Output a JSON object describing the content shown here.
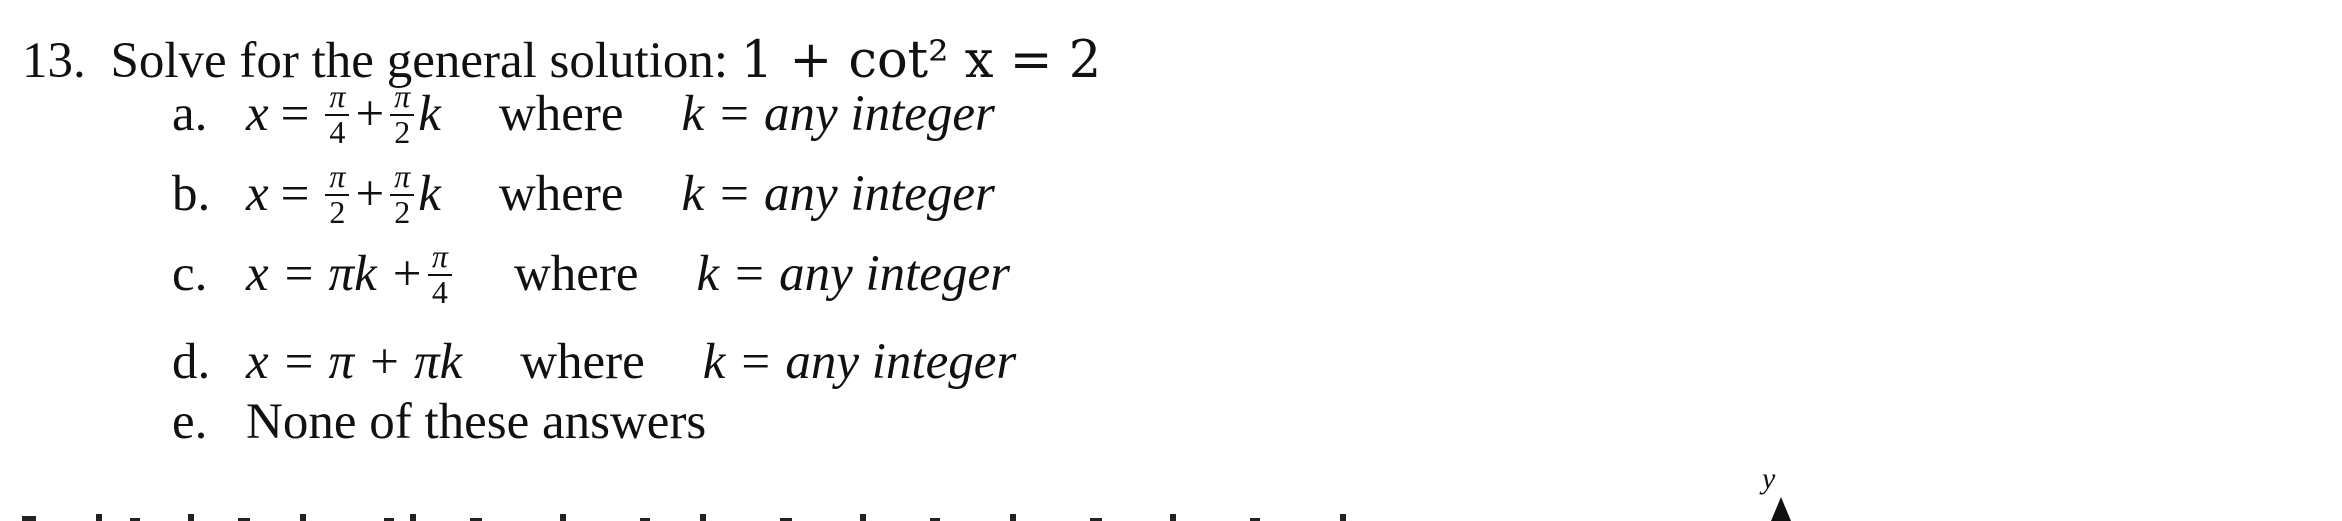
{
  "question": {
    "number": "13.",
    "prompt": "Solve for the general solution:",
    "equation": "1 + cot² x = 2"
  },
  "choices": [
    {
      "letter": "a.",
      "x": "x",
      "eq": "=",
      "frac1_num": "π",
      "frac1_den": "4",
      "plus": "+",
      "frac2_num": "π",
      "frac2_den": "2",
      "k": "k",
      "where": "where",
      "condition": "k = any integer"
    },
    {
      "letter": "b.",
      "x": "x",
      "eq": "=",
      "frac1_num": "π",
      "frac1_den": "2",
      "plus": "+",
      "frac2_num": "π",
      "frac2_den": "2",
      "k": "k",
      "where": "where",
      "condition": "k = any integer"
    },
    {
      "letter": "c.",
      "expr_lead": "x = πk +",
      "frac_num": "π",
      "frac_den": "4",
      "where": "where",
      "condition": "k = any integer"
    },
    {
      "letter": "d.",
      "expr": "x = π + πk",
      "where": "where",
      "condition": "k = any integer"
    },
    {
      "letter": "e.",
      "text": "None of these answers"
    }
  ],
  "figure": {
    "axis_label": "y"
  }
}
